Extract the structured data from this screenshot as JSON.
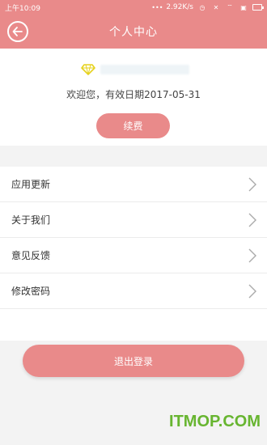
{
  "status_bar": {
    "time": "上午10:09",
    "speed": "2.92K/s"
  },
  "header": {
    "title": "个人中心"
  },
  "profile": {
    "vip_icon": "diamond-icon",
    "welcome_text": "欢迎您，有效日期2017-05-31",
    "renew_label": "续费"
  },
  "menu": {
    "items": [
      {
        "label": "应用更新",
        "icon": "chevron-right-icon"
      },
      {
        "label": "关于我们",
        "icon": "chevron-right-icon"
      },
      {
        "label": "意见反馈",
        "icon": "chevron-right-icon"
      },
      {
        "label": "修改密码",
        "icon": "chevron-right-icon"
      }
    ]
  },
  "logout_label": "退出登录",
  "watermark": "ITMOP.COM",
  "colors": {
    "accent": "#e98a8a",
    "background": "#f3f3f3",
    "watermark": "#67b530"
  }
}
